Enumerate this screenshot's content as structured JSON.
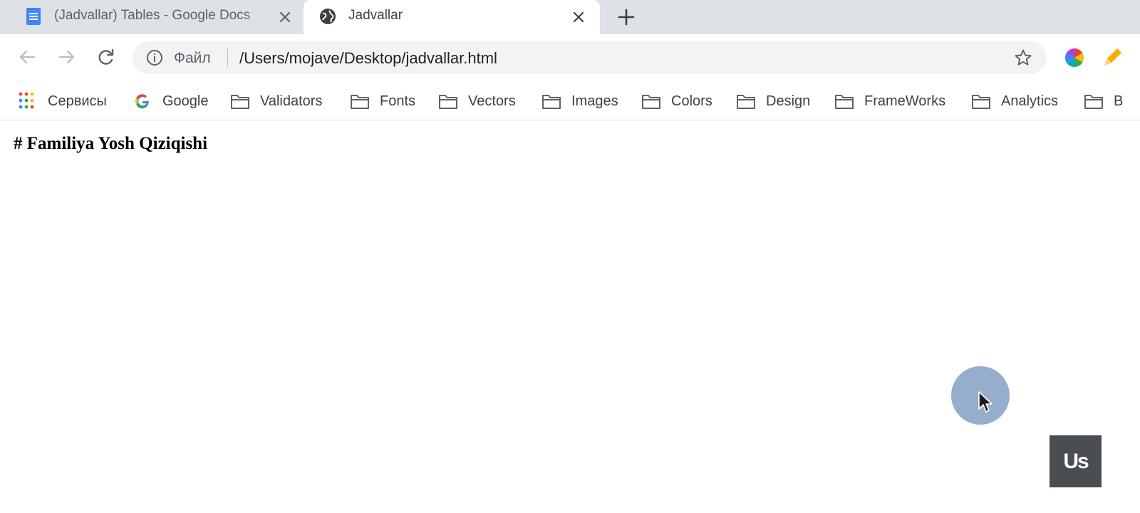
{
  "browser": {
    "tabs": [
      {
        "title": "(Jadvallar) Tables - Google Docs",
        "icon": "google-docs-icon",
        "active": false
      },
      {
        "title": "Jadvallar",
        "icon": "globe-icon",
        "active": true
      }
    ],
    "new_tab_icon": "plus-icon",
    "address_bar": {
      "scheme_label": "Файл",
      "url": "/Users/mojave/Desktop/jadvallar.html"
    },
    "bookmarks": [
      {
        "label": "Сервисы",
        "icon": "apps-grid-icon"
      },
      {
        "label": "Google",
        "icon": "google-icon"
      },
      {
        "label": "Validators",
        "icon": "folder-icon"
      },
      {
        "label": "Fonts",
        "icon": "folder-icon"
      },
      {
        "label": "Vectors",
        "icon": "folder-icon"
      },
      {
        "label": "Images",
        "icon": "folder-icon"
      },
      {
        "label": "Colors",
        "icon": "folder-icon"
      },
      {
        "label": "Design",
        "icon": "folder-icon"
      },
      {
        "label": "FrameWorks",
        "icon": "folder-icon"
      },
      {
        "label": "Analytics",
        "icon": "folder-icon"
      },
      {
        "label": "B",
        "icon": "folder-icon"
      }
    ]
  },
  "page": {
    "heading": "# Familiya Yosh Qiziqishi"
  },
  "watermark": {
    "text": "Us"
  },
  "colors": {
    "tabstrip_bg": "#dee1e6",
    "omnibox_bg": "#f1f3f4",
    "cursor_highlight": "#7896be",
    "docs_blue": "#4285f4"
  }
}
